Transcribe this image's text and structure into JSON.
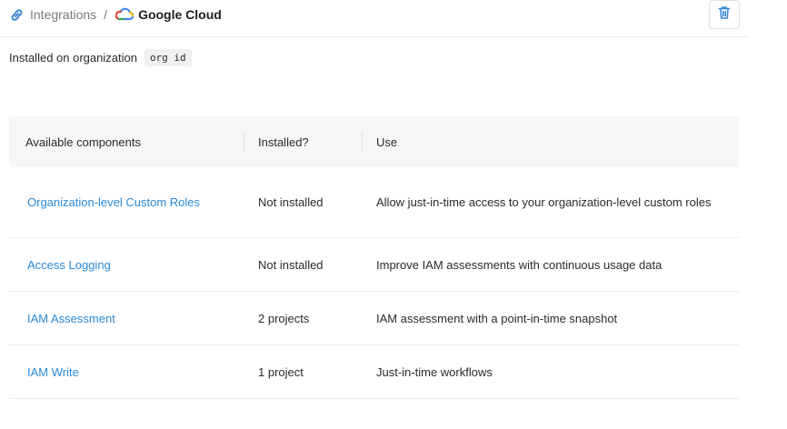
{
  "breadcrumb": {
    "parent": "Integrations",
    "separator": "/",
    "current": "Google Cloud"
  },
  "icons": {
    "integrations": "link-icon",
    "provider": "google-cloud-icon",
    "delete": "trash-icon"
  },
  "installed_on": {
    "label": "Installed on organization",
    "org": "org id"
  },
  "table": {
    "headers": [
      "Available components",
      "Installed?",
      "Use"
    ],
    "rows": [
      {
        "component": "Organization-level Custom Roles",
        "installed": "Not installed",
        "use": "Allow just-in-time access to your organization-level custom roles"
      },
      {
        "component": "Access Logging",
        "installed": "Not installed",
        "use": "Improve IAM assessments with continuous usage data"
      },
      {
        "component": "IAM Assessment",
        "installed": "2 projects",
        "use": "IAM assessment with a point-in-time snapshot"
      },
      {
        "component": "IAM Write",
        "installed": "1 project",
        "use": "Just-in-time workflows"
      }
    ]
  },
  "colors": {
    "link": "#2b8ad6",
    "integrations_icon": "#3a86d4",
    "delete_icon": "#3a86d4"
  }
}
